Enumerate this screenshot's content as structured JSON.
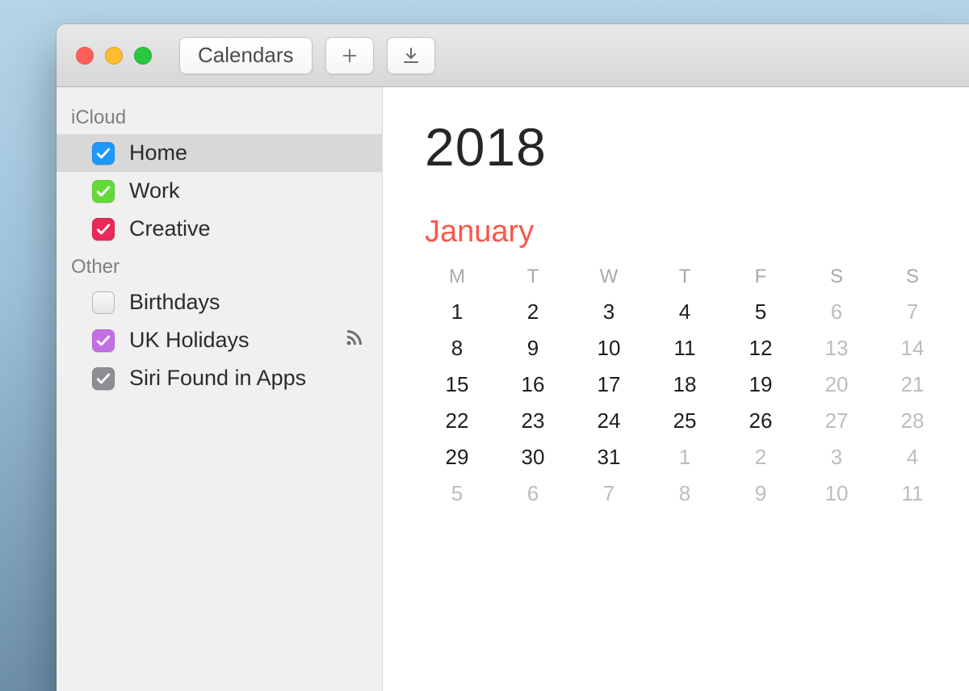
{
  "toolbar": {
    "calendars_label": "Calendars"
  },
  "sidebar": {
    "sections": [
      {
        "title": "iCloud",
        "items": [
          {
            "label": "Home",
            "color": "#1c98fe",
            "checked": true,
            "selected": true
          },
          {
            "label": "Work",
            "color": "#63da38",
            "checked": true,
            "selected": false
          },
          {
            "label": "Creative",
            "color": "#e92a58",
            "checked": true,
            "selected": false
          }
        ]
      },
      {
        "title": "Other",
        "items": [
          {
            "label": "Birthdays",
            "color": "#8e8e92",
            "checked": false,
            "selected": false,
            "subscribed": false
          },
          {
            "label": "UK Holidays",
            "color": "#c56fe4",
            "checked": true,
            "selected": false,
            "subscribed": true
          },
          {
            "label": "Siri Found in Apps",
            "color": "#8e8e92",
            "checked": true,
            "selected": false,
            "subscribed": false
          }
        ]
      }
    ]
  },
  "calendar": {
    "year": "2018",
    "month": "January",
    "weekdays": [
      "M",
      "T",
      "W",
      "T",
      "F",
      "S",
      "S"
    ],
    "weeks": [
      [
        {
          "n": "1",
          "off": false
        },
        {
          "n": "2",
          "off": false
        },
        {
          "n": "3",
          "off": false
        },
        {
          "n": "4",
          "off": false
        },
        {
          "n": "5",
          "off": false
        },
        {
          "n": "6",
          "off": true
        },
        {
          "n": "7",
          "off": true
        }
      ],
      [
        {
          "n": "8",
          "off": false
        },
        {
          "n": "9",
          "off": false
        },
        {
          "n": "10",
          "off": false
        },
        {
          "n": "11",
          "off": false
        },
        {
          "n": "12",
          "off": false
        },
        {
          "n": "13",
          "off": true
        },
        {
          "n": "14",
          "off": true
        }
      ],
      [
        {
          "n": "15",
          "off": false
        },
        {
          "n": "16",
          "off": false
        },
        {
          "n": "17",
          "off": false
        },
        {
          "n": "18",
          "off": false
        },
        {
          "n": "19",
          "off": false
        },
        {
          "n": "20",
          "off": true
        },
        {
          "n": "21",
          "off": true
        }
      ],
      [
        {
          "n": "22",
          "off": false
        },
        {
          "n": "23",
          "off": false
        },
        {
          "n": "24",
          "off": false
        },
        {
          "n": "25",
          "off": false
        },
        {
          "n": "26",
          "off": false
        },
        {
          "n": "27",
          "off": true
        },
        {
          "n": "28",
          "off": true
        }
      ],
      [
        {
          "n": "29",
          "off": false
        },
        {
          "n": "30",
          "off": false
        },
        {
          "n": "31",
          "off": false
        },
        {
          "n": "1",
          "off": true
        },
        {
          "n": "2",
          "off": true
        },
        {
          "n": "3",
          "off": true
        },
        {
          "n": "4",
          "off": true
        }
      ],
      [
        {
          "n": "5",
          "off": true
        },
        {
          "n": "6",
          "off": true
        },
        {
          "n": "7",
          "off": true
        },
        {
          "n": "8",
          "off": true
        },
        {
          "n": "9",
          "off": true
        },
        {
          "n": "10",
          "off": true
        },
        {
          "n": "11",
          "off": true
        }
      ]
    ]
  }
}
